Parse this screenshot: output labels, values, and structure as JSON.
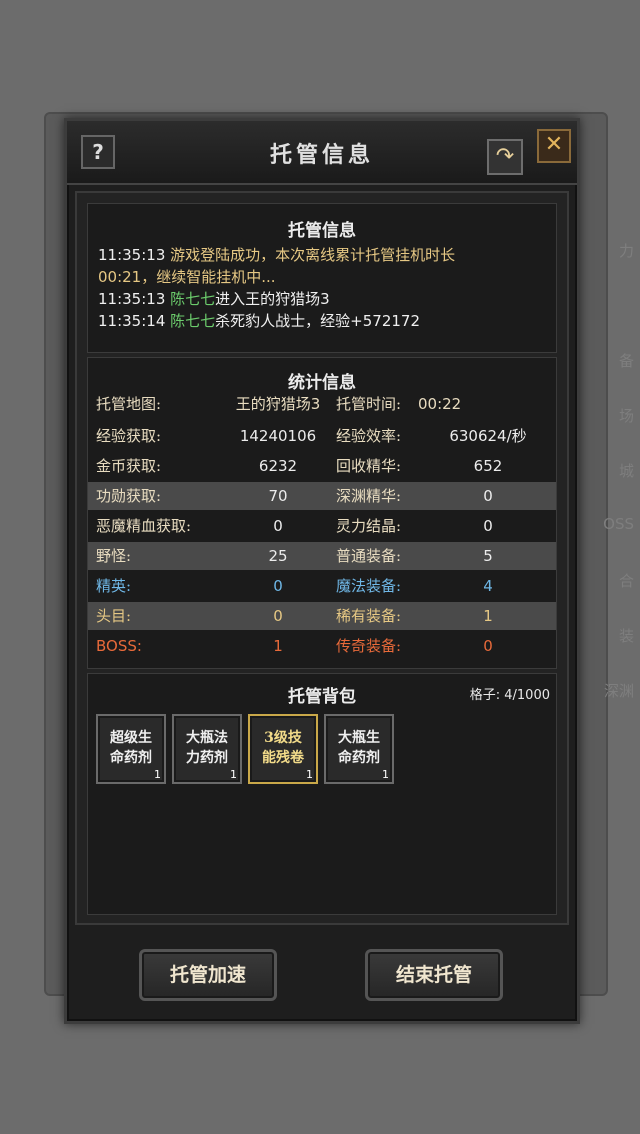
{
  "background": {
    "side_labels": [
      "力",
      "备",
      "场",
      "城",
      "OSS",
      "合",
      "装",
      "深渊"
    ]
  },
  "window": {
    "title": "托管信息",
    "help_label": "?",
    "share_label": "↷",
    "close_label": "✕"
  },
  "log": {
    "title": "托管信息",
    "entries": [
      {
        "time": "11:35:13",
        "text": "游戏登陆成功，本次离线累计托管挂机时长",
        "text2": "00:21，继续智能挂机中..."
      },
      {
        "time": "11:35:13",
        "name": "陈七七",
        "text": "进入王的狩猎场3"
      },
      {
        "time": "11:35:14",
        "name": "陈七七",
        "text": "杀死豹人战士，经验+572172"
      }
    ]
  },
  "stats": {
    "title": "统计信息",
    "rows": [
      {
        "l1": "托管地图:",
        "v1": "王的狩猎场3",
        "l2": "托管时间:",
        "v2": "00:22"
      },
      {
        "l1": "经验获取:",
        "v1": "14240106",
        "l2": "经验效率:",
        "v2": "630624/秒"
      },
      {
        "l1": "金币获取:",
        "v1": "6232",
        "l2": "回收精华:",
        "v2": "652"
      },
      {
        "l1": "功勋获取:",
        "v1": "70",
        "l2": "深渊精华:",
        "v2": "0"
      },
      {
        "l1": "恶魔精血获取:",
        "v1": "0",
        "l2": "灵力结晶:",
        "v2": "0"
      },
      {
        "l1": "野怪:",
        "v1": "25",
        "l2": "普通装备:",
        "v2": "5"
      },
      {
        "l1": "精英:",
        "v1": "0",
        "l2": "魔法装备:",
        "v2": "4"
      },
      {
        "l1": "头目:",
        "v1": "0",
        "l2": "稀有装备:",
        "v2": "1"
      },
      {
        "l1": "BOSS:",
        "v1": "1",
        "l2": "传奇装备:",
        "v2": "0"
      }
    ]
  },
  "bag": {
    "title": "托管背包",
    "capacity": "格子: 4/1000",
    "items": [
      {
        "line1": "超级生",
        "line2": "命药剂",
        "count": "1"
      },
      {
        "line1": "大瓶法",
        "line2": "力药剂",
        "count": "1"
      },
      {
        "line1": "3级技",
        "line2": "能残卷",
        "count": "1"
      },
      {
        "line1": "大瓶生",
        "line2": "命药剂",
        "count": "1"
      }
    ]
  },
  "buttons": {
    "speed_up": "托管加速",
    "end": "结束托管"
  }
}
